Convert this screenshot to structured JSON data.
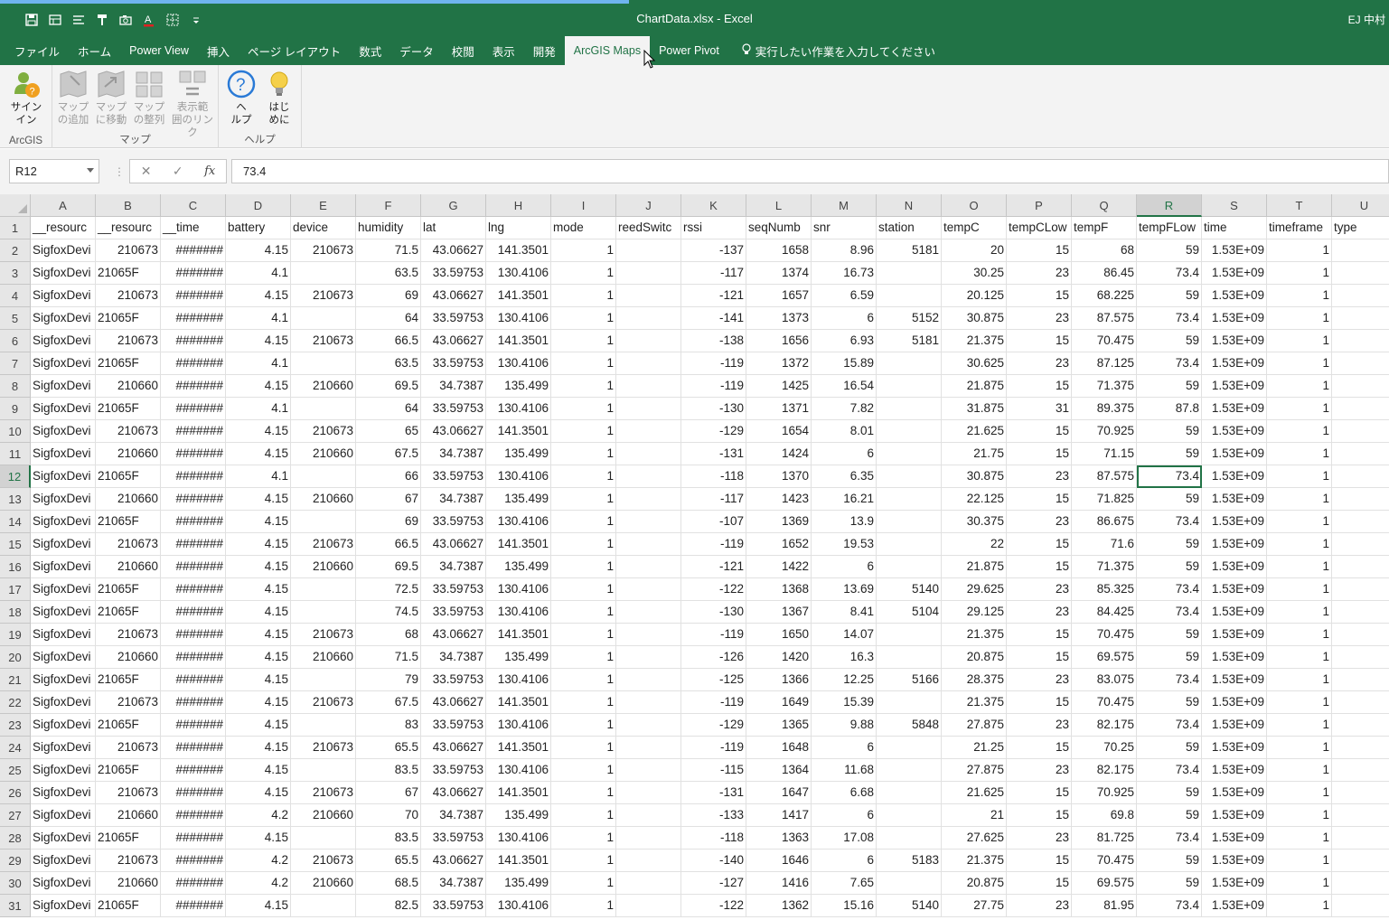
{
  "window": {
    "title": "ChartData.xlsx  -  Excel",
    "user": "EJ 中村 "
  },
  "qat": {
    "icons": [
      "save-icon",
      "touch-mode-icon",
      "list-icon",
      "format-painter-icon",
      "camera-icon",
      "font-color-icon",
      "borders-icon",
      "customize-icon"
    ]
  },
  "tabs": [
    "ファイル",
    "ホーム",
    "Power View",
    "挿入",
    "ページ レイアウト",
    "数式",
    "データ",
    "校閲",
    "表示",
    "開発",
    "ArcGIS Maps",
    "Power Pivot"
  ],
  "active_tab": "ArcGIS Maps",
  "tell_me": "実行したい作業を入力してください",
  "ribbon": {
    "groups": [
      {
        "label": "ArcGIS",
        "buttons": [
          {
            "label": "サイン\nイン",
            "icon": "sign-in-icon",
            "enabled": true
          }
        ]
      },
      {
        "label": "マップ",
        "buttons": [
          {
            "label": "マップ\nの追加",
            "icon": "add-map-icon",
            "enabled": false
          },
          {
            "label": "マップ\nに移動",
            "icon": "go-to-map-icon",
            "enabled": false
          },
          {
            "label": "マップ\nの整列",
            "icon": "arrange-maps-icon",
            "enabled": false
          },
          {
            "label": "表示範\n囲のリンク",
            "icon": "link-extent-icon",
            "enabled": false
          }
        ]
      },
      {
        "label": "ヘルプ",
        "buttons": [
          {
            "label": "ヘ\nルプ",
            "icon": "help-icon",
            "enabled": true
          },
          {
            "label": "はじ\nめに",
            "icon": "lightbulb-icon",
            "enabled": true
          }
        ]
      }
    ]
  },
  "formula_bar": {
    "name_box": "R12",
    "value": "73.4"
  },
  "sheet": {
    "columns": [
      "A",
      "B",
      "C",
      "D",
      "E",
      "F",
      "G",
      "H",
      "I",
      "J",
      "K",
      "L",
      "M",
      "N",
      "O",
      "P",
      "Q",
      "R",
      "S",
      "T",
      "U"
    ],
    "selected_column": "R",
    "selected_row": 12,
    "headers": [
      "__resourc",
      "__resourc",
      "__time",
      "battery",
      "device",
      "humidity",
      "lat",
      "lng",
      "mode",
      "reedSwitc",
      "rssi",
      "seqNumb",
      "snr",
      "station",
      "tempC",
      "tempCLow",
      "tempF",
      "tempFLow",
      "time",
      "timeframe",
      "type"
    ],
    "rows": [
      [
        "SigfoxDevi",
        "210673",
        "#######",
        "4.15",
        "210673",
        "71.5",
        "43.06627",
        "141.3501",
        "1",
        "",
        "-137",
        "1658",
        "8.96",
        "5181",
        "20",
        "15",
        "68",
        "59",
        "1.53E+09",
        "1",
        ""
      ],
      [
        "SigfoxDevi",
        "21065F",
        "#######",
        "4.1",
        "",
        "63.5",
        "33.59753",
        "130.4106",
        "1",
        "",
        "-117",
        "1374",
        "16.73",
        "",
        "30.25",
        "23",
        "86.45",
        "73.4",
        "1.53E+09",
        "1",
        ""
      ],
      [
        "SigfoxDevi",
        "210673",
        "#######",
        "4.15",
        "210673",
        "69",
        "43.06627",
        "141.3501",
        "1",
        "",
        "-121",
        "1657",
        "6.59",
        "",
        "20.125",
        "15",
        "68.225",
        "59",
        "1.53E+09",
        "1",
        ""
      ],
      [
        "SigfoxDevi",
        "21065F",
        "#######",
        "4.1",
        "",
        "64",
        "33.59753",
        "130.4106",
        "1",
        "",
        "-141",
        "1373",
        "6",
        "5152",
        "30.875",
        "23",
        "87.575",
        "73.4",
        "1.53E+09",
        "1",
        ""
      ],
      [
        "SigfoxDevi",
        "210673",
        "#######",
        "4.15",
        "210673",
        "66.5",
        "43.06627",
        "141.3501",
        "1",
        "",
        "-138",
        "1656",
        "6.93",
        "5181",
        "21.375",
        "15",
        "70.475",
        "59",
        "1.53E+09",
        "1",
        ""
      ],
      [
        "SigfoxDevi",
        "21065F",
        "#######",
        "4.1",
        "",
        "63.5",
        "33.59753",
        "130.4106",
        "1",
        "",
        "-119",
        "1372",
        "15.89",
        "",
        "30.625",
        "23",
        "87.125",
        "73.4",
        "1.53E+09",
        "1",
        ""
      ],
      [
        "SigfoxDevi",
        "210660",
        "#######",
        "4.15",
        "210660",
        "69.5",
        "34.7387",
        "135.499",
        "1",
        "",
        "-119",
        "1425",
        "16.54",
        "",
        "21.875",
        "15",
        "71.375",
        "59",
        "1.53E+09",
        "1",
        ""
      ],
      [
        "SigfoxDevi",
        "21065F",
        "#######",
        "4.1",
        "",
        "64",
        "33.59753",
        "130.4106",
        "1",
        "",
        "-130",
        "1371",
        "7.82",
        "",
        "31.875",
        "31",
        "89.375",
        "87.8",
        "1.53E+09",
        "1",
        ""
      ],
      [
        "SigfoxDevi",
        "210673",
        "#######",
        "4.15",
        "210673",
        "65",
        "43.06627",
        "141.3501",
        "1",
        "",
        "-129",
        "1654",
        "8.01",
        "",
        "21.625",
        "15",
        "70.925",
        "59",
        "1.53E+09",
        "1",
        ""
      ],
      [
        "SigfoxDevi",
        "210660",
        "#######",
        "4.15",
        "210660",
        "67.5",
        "34.7387",
        "135.499",
        "1",
        "",
        "-131",
        "1424",
        "6",
        "",
        "21.75",
        "15",
        "71.15",
        "59",
        "1.53E+09",
        "1",
        ""
      ],
      [
        "SigfoxDevi",
        "21065F",
        "#######",
        "4.1",
        "",
        "66",
        "33.59753",
        "130.4106",
        "1",
        "",
        "-118",
        "1370",
        "6.35",
        "",
        "30.875",
        "23",
        "87.575",
        "73.4",
        "1.53E+09",
        "1",
        ""
      ],
      [
        "SigfoxDevi",
        "210660",
        "#######",
        "4.15",
        "210660",
        "67",
        "34.7387",
        "135.499",
        "1",
        "",
        "-117",
        "1423",
        "16.21",
        "",
        "22.125",
        "15",
        "71.825",
        "59",
        "1.53E+09",
        "1",
        ""
      ],
      [
        "SigfoxDevi",
        "21065F",
        "#######",
        "4.15",
        "",
        "69",
        "33.59753",
        "130.4106",
        "1",
        "",
        "-107",
        "1369",
        "13.9",
        "",
        "30.375",
        "23",
        "86.675",
        "73.4",
        "1.53E+09",
        "1",
        ""
      ],
      [
        "SigfoxDevi",
        "210673",
        "#######",
        "4.15",
        "210673",
        "66.5",
        "43.06627",
        "141.3501",
        "1",
        "",
        "-119",
        "1652",
        "19.53",
        "",
        "22",
        "15",
        "71.6",
        "59",
        "1.53E+09",
        "1",
        ""
      ],
      [
        "SigfoxDevi",
        "210660",
        "#######",
        "4.15",
        "210660",
        "69.5",
        "34.7387",
        "135.499",
        "1",
        "",
        "-121",
        "1422",
        "6",
        "",
        "21.875",
        "15",
        "71.375",
        "59",
        "1.53E+09",
        "1",
        ""
      ],
      [
        "SigfoxDevi",
        "21065F",
        "#######",
        "4.15",
        "",
        "72.5",
        "33.59753",
        "130.4106",
        "1",
        "",
        "-122",
        "1368",
        "13.69",
        "5140",
        "29.625",
        "23",
        "85.325",
        "73.4",
        "1.53E+09",
        "1",
        ""
      ],
      [
        "SigfoxDevi",
        "21065F",
        "#######",
        "4.15",
        "",
        "74.5",
        "33.59753",
        "130.4106",
        "1",
        "",
        "-130",
        "1367",
        "8.41",
        "5104",
        "29.125",
        "23",
        "84.425",
        "73.4",
        "1.53E+09",
        "1",
        ""
      ],
      [
        "SigfoxDevi",
        "210673",
        "#######",
        "4.15",
        "210673",
        "68",
        "43.06627",
        "141.3501",
        "1",
        "",
        "-119",
        "1650",
        "14.07",
        "",
        "21.375",
        "15",
        "70.475",
        "59",
        "1.53E+09",
        "1",
        ""
      ],
      [
        "SigfoxDevi",
        "210660",
        "#######",
        "4.15",
        "210660",
        "71.5",
        "34.7387",
        "135.499",
        "1",
        "",
        "-126",
        "1420",
        "16.3",
        "",
        "20.875",
        "15",
        "69.575",
        "59",
        "1.53E+09",
        "1",
        ""
      ],
      [
        "SigfoxDevi",
        "21065F",
        "#######",
        "4.15",
        "",
        "79",
        "33.59753",
        "130.4106",
        "1",
        "",
        "-125",
        "1366",
        "12.25",
        "5166",
        "28.375",
        "23",
        "83.075",
        "73.4",
        "1.53E+09",
        "1",
        ""
      ],
      [
        "SigfoxDevi",
        "210673",
        "#######",
        "4.15",
        "210673",
        "67.5",
        "43.06627",
        "141.3501",
        "1",
        "",
        "-119",
        "1649",
        "15.39",
        "",
        "21.375",
        "15",
        "70.475",
        "59",
        "1.53E+09",
        "1",
        ""
      ],
      [
        "SigfoxDevi",
        "21065F",
        "#######",
        "4.15",
        "",
        "83",
        "33.59753",
        "130.4106",
        "1",
        "",
        "-129",
        "1365",
        "9.88",
        "5848",
        "27.875",
        "23",
        "82.175",
        "73.4",
        "1.53E+09",
        "1",
        ""
      ],
      [
        "SigfoxDevi",
        "210673",
        "#######",
        "4.15",
        "210673",
        "65.5",
        "43.06627",
        "141.3501",
        "1",
        "",
        "-119",
        "1648",
        "6",
        "",
        "21.25",
        "15",
        "70.25",
        "59",
        "1.53E+09",
        "1",
        ""
      ],
      [
        "SigfoxDevi",
        "21065F",
        "#######",
        "4.15",
        "",
        "83.5",
        "33.59753",
        "130.4106",
        "1",
        "",
        "-115",
        "1364",
        "11.68",
        "",
        "27.875",
        "23",
        "82.175",
        "73.4",
        "1.53E+09",
        "1",
        ""
      ],
      [
        "SigfoxDevi",
        "210673",
        "#######",
        "4.15",
        "210673",
        "67",
        "43.06627",
        "141.3501",
        "1",
        "",
        "-131",
        "1647",
        "6.68",
        "",
        "21.625",
        "15",
        "70.925",
        "59",
        "1.53E+09",
        "1",
        ""
      ],
      [
        "SigfoxDevi",
        "210660",
        "#######",
        "4.2",
        "210660",
        "70",
        "34.7387",
        "135.499",
        "1",
        "",
        "-133",
        "1417",
        "6",
        "",
        "21",
        "15",
        "69.8",
        "59",
        "1.53E+09",
        "1",
        ""
      ],
      [
        "SigfoxDevi",
        "21065F",
        "#######",
        "4.15",
        "",
        "83.5",
        "33.59753",
        "130.4106",
        "1",
        "",
        "-118",
        "1363",
        "17.08",
        "",
        "27.625",
        "23",
        "81.725",
        "73.4",
        "1.53E+09",
        "1",
        ""
      ],
      [
        "SigfoxDevi",
        "210673",
        "#######",
        "4.2",
        "210673",
        "65.5",
        "43.06627",
        "141.3501",
        "1",
        "",
        "-140",
        "1646",
        "6",
        "5183",
        "21.375",
        "15",
        "70.475",
        "59",
        "1.53E+09",
        "1",
        ""
      ],
      [
        "SigfoxDevi",
        "210660",
        "#######",
        "4.2",
        "210660",
        "68.5",
        "34.7387",
        "135.499",
        "1",
        "",
        "-127",
        "1416",
        "7.65",
        "",
        "20.875",
        "15",
        "69.575",
        "59",
        "1.53E+09",
        "1",
        ""
      ],
      [
        "SigfoxDevi",
        "21065F",
        "#######",
        "4.15",
        "",
        "82.5",
        "33.59753",
        "130.4106",
        "1",
        "",
        "-122",
        "1362",
        "15.16",
        "5140",
        "27.75",
        "23",
        "81.95",
        "73.4",
        "1.53E+09",
        "1",
        ""
      ]
    ]
  },
  "colors": {
    "excel_green": "#217346",
    "ribbon_bg": "#f3f3f3"
  }
}
